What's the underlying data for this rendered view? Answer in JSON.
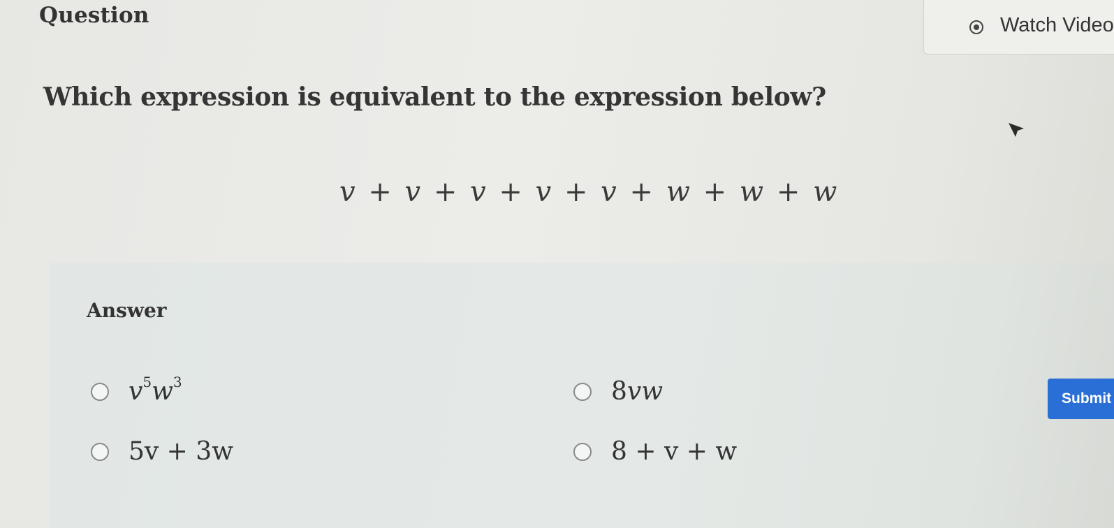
{
  "header": {
    "title": "Question",
    "watch_video_label": "Watch Video"
  },
  "question": {
    "prompt": "Which expression is equivalent to the expression below?",
    "expression": "v + v + v + v + v + w + w + w"
  },
  "answer": {
    "label": "Answer",
    "options": [
      {
        "text": "v⁵w³",
        "base1": "v",
        "exp1": "5",
        "base2": "w",
        "exp2": "3",
        "selected": false
      },
      {
        "text": "8vw",
        "coef": "8",
        "vars": "vw",
        "selected": false
      },
      {
        "text": "5v + 3w",
        "selected": false
      },
      {
        "text": "8 + v + w",
        "selected": false
      }
    ]
  },
  "submit": {
    "label": "Submit",
    "color": "#2a6fd6"
  },
  "icons": {
    "watch_video": "play-circle-icon",
    "cursor": "mouse-pointer-icon"
  }
}
